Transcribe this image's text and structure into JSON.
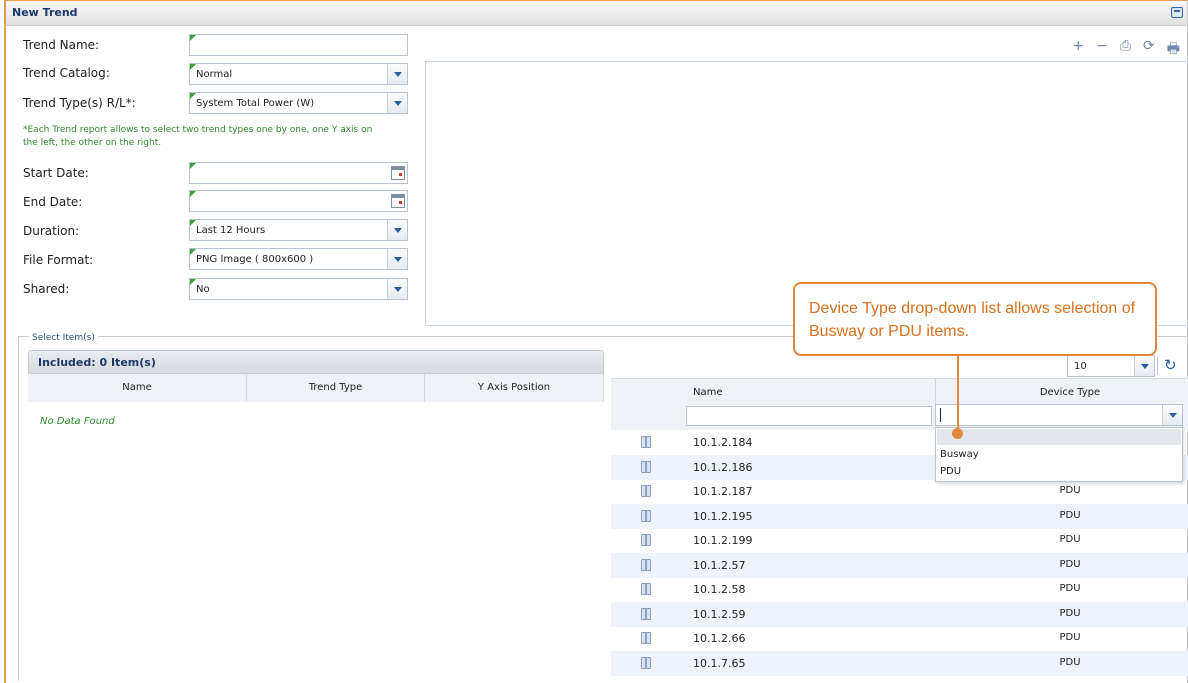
{
  "window": {
    "title": "New Trend"
  },
  "form": {
    "trend_name": {
      "label": "Trend Name:",
      "value": ""
    },
    "trend_catalog": {
      "label": "Trend Catalog:",
      "value": "Normal"
    },
    "trend_types": {
      "label": "Trend Type(s) R/L*:",
      "value": "System Total Power (W)"
    },
    "note": "*Each Trend report allows to select two trend types one by one, one Y axis on the left, the other on the right.",
    "start_date": {
      "label": "Start Date:",
      "value": ""
    },
    "end_date": {
      "label": "End Date:",
      "value": ""
    },
    "duration": {
      "label": "Duration:",
      "value": "Last 12 Hours"
    },
    "file_format": {
      "label": "File Format:",
      "value": "PNG Image ( 800x600 )"
    },
    "shared": {
      "label": "Shared:",
      "value": "No"
    }
  },
  "toolbar": {
    "zoom_in": "+",
    "zoom_out": "−",
    "save": "⎙",
    "refresh": "⟳",
    "print": "🖶"
  },
  "select_items": {
    "legend": "Select Item(s)",
    "included_title": "Included: 0 Item(s)",
    "columns": [
      "Name",
      "Trend Type",
      "Y Axis Position"
    ],
    "empty_text": "No Data Found"
  },
  "devices": {
    "page_size": "10",
    "refresh_icon": "↻",
    "columns": {
      "name": "Name",
      "device_type": "Device Type"
    },
    "dropdown_options": [
      "Busway",
      "PDU"
    ],
    "rows": [
      {
        "name": "10.1.2.184",
        "type": ""
      },
      {
        "name": "10.1.2.186",
        "type": ""
      },
      {
        "name": "10.1.2.187",
        "type": "PDU"
      },
      {
        "name": "10.1.2.195",
        "type": "PDU"
      },
      {
        "name": "10.1.2.199",
        "type": "PDU"
      },
      {
        "name": "10.1.2.57",
        "type": "PDU"
      },
      {
        "name": "10.1.2.58",
        "type": "PDU"
      },
      {
        "name": "10.1.2.59",
        "type": "PDU"
      },
      {
        "name": "10.1.2.66",
        "type": "PDU"
      },
      {
        "name": "10.1.7.65",
        "type": "PDU"
      }
    ]
  },
  "callout": {
    "text": "Device Type drop-down list allows selection of Busway or PDU items."
  },
  "colors": {
    "accent": "#e0883a",
    "header": "#1b3a66",
    "note": "#2f8a2f"
  }
}
